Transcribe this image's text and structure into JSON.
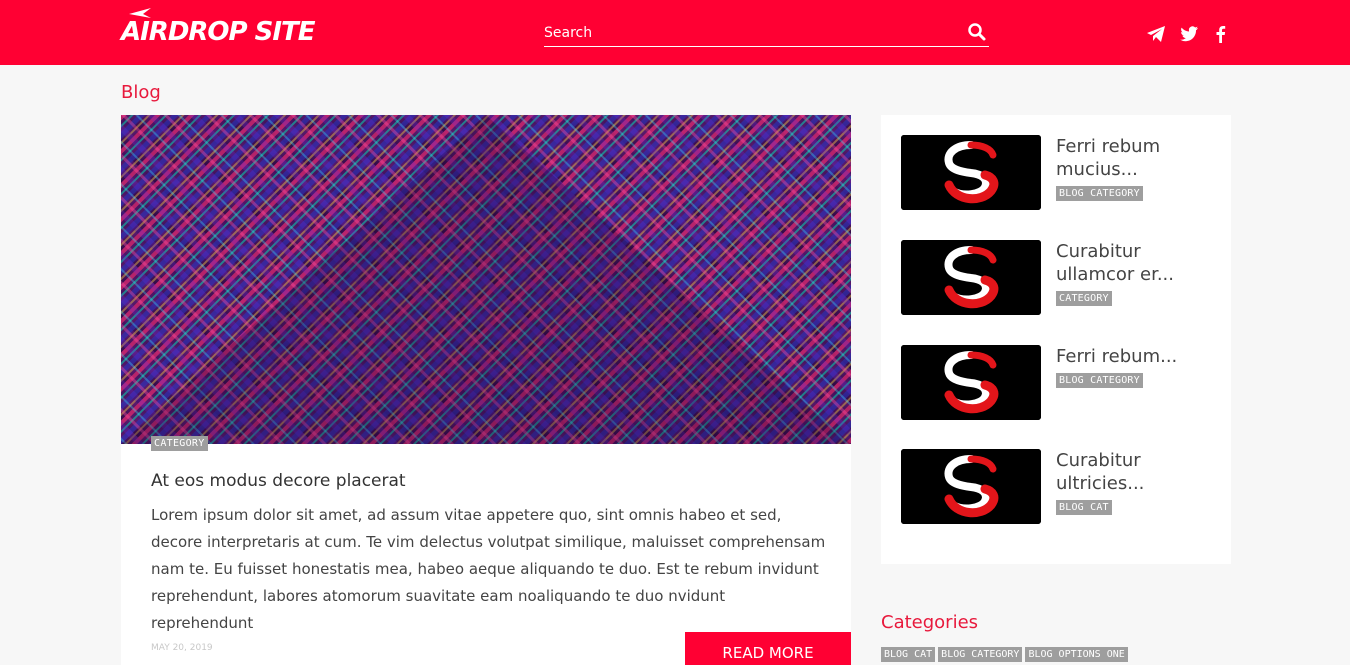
{
  "header": {
    "logo_text": "AIRDROP SITE",
    "search_placeholder": "Search",
    "social": [
      "telegram-icon",
      "twitter-icon",
      "facebook-icon"
    ]
  },
  "page": {
    "title": "Blog"
  },
  "featured": {
    "category": "CATEGORY",
    "title": "At eos modus decore placerat",
    "body": "Lorem ipsum dolor sit amet, ad assum vitae appetere quo, sint omnis habeo et sed, decore interpretaris at cum. Te vim delectus volutpat similique, maluisset comprehensam nam te. Eu fuisset honestatis mea, habeo aeque aliquando te duo. Est te rebum invidunt reprehendunt, labores atomorum suavitate eam noaliquando te duo nvidunt reprehendunt",
    "date": "MAY 20, 2019",
    "read_more": "READ MORE"
  },
  "sidebar": {
    "items": [
      {
        "title": "Ferri rebum mucius...",
        "tag": "BLOG CATEGORY"
      },
      {
        "title": "Curabitur ullamcor er...",
        "tag": "CATEGORY"
      },
      {
        "title": "Ferri rebum...",
        "tag": "BLOG CATEGORY"
      },
      {
        "title": "Curabitur ultricies...",
        "tag": "BLOG CAT"
      }
    ]
  },
  "categories": {
    "heading": "Categories",
    "items": [
      "BLOG CAT",
      "BLOG CATEGORY",
      "BLOG OPTIONS ONE"
    ]
  },
  "colors": {
    "brand": "#ff0033",
    "accent_text": "#e8193c",
    "tag_bg": "#9e9e9e"
  }
}
